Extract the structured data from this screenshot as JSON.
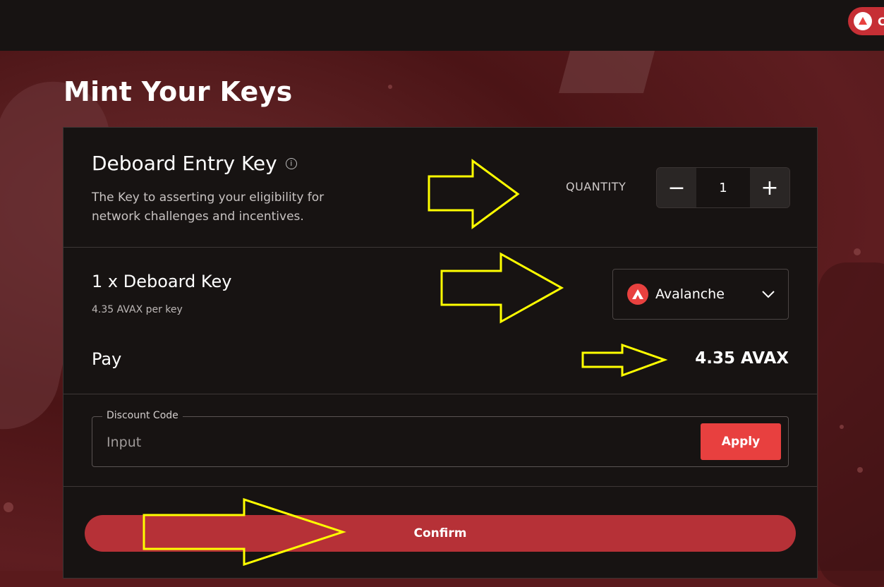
{
  "header": {
    "network_pill_text": "C"
  },
  "page_title": "Mint Your Keys",
  "product": {
    "title": "Deboard Entry Key",
    "description": "The Key to asserting your eligibility for network challenges and incentives.",
    "quantity_label": "QUANTITY",
    "quantity_value": "1",
    "minus_symbol": "−",
    "plus_symbol": "+"
  },
  "order": {
    "item_label": "1 x Deboard Key",
    "price_per_key": "4.35 AVAX per key",
    "network_selected": "Avalanche",
    "pay_label": "Pay",
    "pay_amount": "4.35 AVAX"
  },
  "discount": {
    "label": "Discount Code",
    "placeholder": "Input",
    "apply_label": "Apply"
  },
  "confirm_label": "Confirm",
  "colors": {
    "accent": "#e8403f",
    "confirm": "#b63137",
    "annotation_arrow": "#ffff00",
    "card_bg": "#171312"
  },
  "icons": {
    "info": "info-icon",
    "network": "avalanche-icon",
    "dropdown": "chevron-down-icon"
  }
}
